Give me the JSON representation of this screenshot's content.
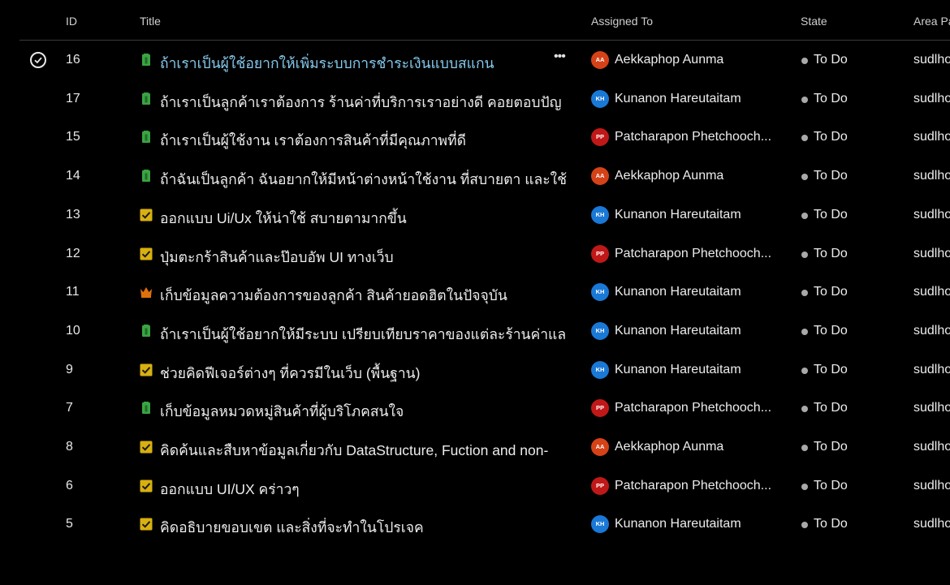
{
  "columns": {
    "id": "ID",
    "title": "Title",
    "assigned_to": "Assigned To",
    "state": "State",
    "area": "Area Pa"
  },
  "colors": {
    "avatar_AA": "#d64218",
    "avatar_KH": "#1a78d6",
    "avatar_PP": "#c01818",
    "icon_story": "#3aa443",
    "icon_task": "#d8b010",
    "icon_feature": "#e0700b",
    "selected_title": "#86c9ec",
    "state_dot": "#a9a9a9"
  },
  "rows": [
    {
      "id": "16",
      "type": "story",
      "title": "ถ้าเราเป็นผู้ใช้อยากให้เพิ่มระบบการชำระเงินแบบสแกน",
      "initials": "AA",
      "assignee": "Aekkaphop Aunma",
      "state": "To Do",
      "area": "sudlho",
      "selected": true
    },
    {
      "id": "17",
      "type": "story",
      "title": "ถ้าเราเป็นลูกค้าเราต้องการ ร้านค่าที่บริการเราอย่างดี คอยตอบปัญ",
      "initials": "KH",
      "assignee": "Kunanon Hareutaitam",
      "state": "To Do",
      "area": "sudlho"
    },
    {
      "id": "15",
      "type": "story",
      "title": "ถ้าเราเป็นผู้ใช้งาน เราต้องการสินค้าที่มีคุณภาพที่ดี",
      "initials": "PP",
      "assignee": "Patcharapon Phetchooch...",
      "state": "To Do",
      "area": "sudlho"
    },
    {
      "id": "14",
      "type": "story",
      "title": "ถ้าฉันเป็นลูกค้า ฉันอยากให้มีหน้าต่างหน้าใช้งาน ที่สบายตา และใช้",
      "initials": "AA",
      "assignee": "Aekkaphop Aunma",
      "state": "To Do",
      "area": "sudlho"
    },
    {
      "id": "13",
      "type": "task",
      "title": "ออกแบบ Ui/Ux ให้น่าใช้ สบายตามากขึ้น",
      "initials": "KH",
      "assignee": "Kunanon Hareutaitam",
      "state": "To Do",
      "area": "sudlho"
    },
    {
      "id": "12",
      "type": "task",
      "title": "ปุ่มตะกร้าสินค้าและป๊อบอัพ UI ทางเว็บ",
      "initials": "PP",
      "assignee": "Patcharapon Phetchooch...",
      "state": "To Do",
      "area": "sudlho"
    },
    {
      "id": "11",
      "type": "feature",
      "title": "เก็บข้อมูลความต้องการของลูกค้า สินค้ายอดฮิตในปัจจุบัน",
      "initials": "KH",
      "assignee": "Kunanon Hareutaitam",
      "state": "To Do",
      "area": "sudlho"
    },
    {
      "id": "10",
      "type": "story",
      "title": "ถ้าเราเป็นผู้ใช้อยากให้มีระบบ เปรียบเทียบราคาของแต่ละร้านค่าแล",
      "initials": "KH",
      "assignee": "Kunanon Hareutaitam",
      "state": "To Do",
      "area": "sudlho"
    },
    {
      "id": "9",
      "type": "task",
      "title": "ช่วยคิดฟีเจอร์ต่างๆ ที่ควรมีในเว็บ (พื้นฐาน)",
      "initials": "KH",
      "assignee": "Kunanon Hareutaitam",
      "state": "To Do",
      "area": "sudlho"
    },
    {
      "id": "7",
      "type": "story",
      "title": "เก็บข้อมูลหมวดหมู่สินค้าที่ผู้บริโภคสนใจ",
      "initials": "PP",
      "assignee": "Patcharapon Phetchooch...",
      "state": "To Do",
      "area": "sudlho"
    },
    {
      "id": "8",
      "type": "task",
      "title": "คิดค้นและสืบหาข้อมูลเกี่ยวกับ DataStructure, Fuction and non-",
      "initials": "AA",
      "assignee": "Aekkaphop Aunma",
      "state": "To Do",
      "area": "sudlho"
    },
    {
      "id": "6",
      "type": "task",
      "title": "ออกแบบ UI/UX คร่าวๆ",
      "initials": "PP",
      "assignee": "Patcharapon Phetchooch...",
      "state": "To Do",
      "area": "sudlho"
    },
    {
      "id": "5",
      "type": "task",
      "title": "คิดอธิบายขอบเขต และสิ่งที่จะทำในโปรเจค",
      "initials": "KH",
      "assignee": "Kunanon Hareutaitam",
      "state": "To Do",
      "area": "sudlho"
    }
  ]
}
